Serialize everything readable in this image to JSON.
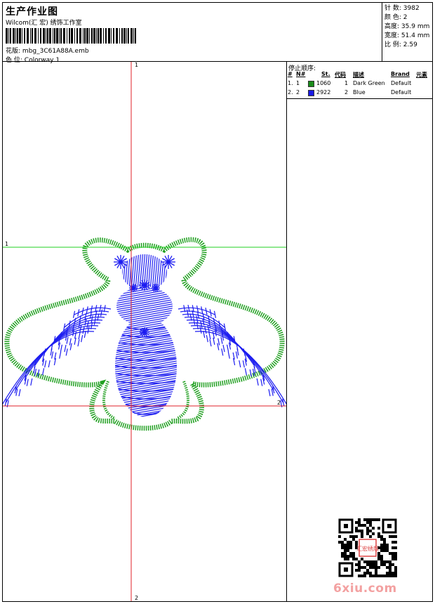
{
  "header": {
    "title": "生产作业图",
    "company": "Wilcom(汇 宏) 绣饰工作室",
    "design_label": "花版:",
    "design_value": "mbg_3C61A88A.emb",
    "colorway_label": "色 位:",
    "colorway_value": "Colorway 1"
  },
  "stats": [
    {
      "label": "针 数:",
      "value": "3982"
    },
    {
      "label": "颜 色:",
      "value": "2"
    },
    {
      "label": "高度:",
      "value": "35.9 mm"
    },
    {
      "label": "宽度:",
      "value": "51.4 mm"
    },
    {
      "label": "比 例:",
      "value": "2.59"
    }
  ],
  "stop_sequence": {
    "title": "停止顺序:",
    "columns": [
      "#",
      "N#",
      "St.",
      "代码",
      "描述",
      "Brand",
      "元素"
    ],
    "rows": [
      {
        "index": "1.",
        "n": "1",
        "color": "#1a8c1a",
        "st": "1060",
        "code": "1",
        "desc": "Dark Green",
        "brand": "Default"
      },
      {
        "index": "2.",
        "n": "2",
        "color": "#1a1ae6",
        "st": "2922",
        "code": "2",
        "desc": "Blue",
        "brand": "Default"
      }
    ]
  },
  "canvas": {
    "axis_top": "1",
    "axis_bottom": "2",
    "axis_left": "1",
    "axis_right": "2",
    "green_color": "#22a022",
    "blue_color": "#1c1cf0",
    "red_line": "#e0202a",
    "green_line": "#20d020"
  },
  "watermark": "6xiu.com",
  "qr_seal": "汇宏绣版"
}
